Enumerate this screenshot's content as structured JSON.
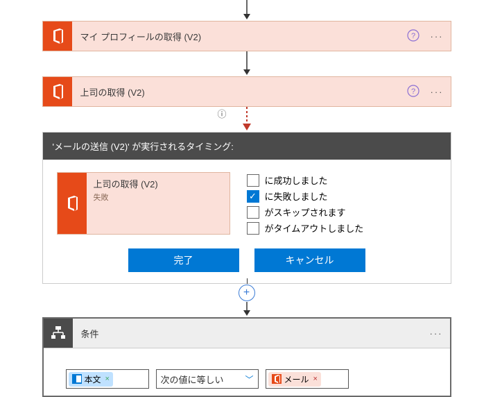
{
  "actions": {
    "profile": {
      "title": "マイ プロフィールの取得 (V2)"
    },
    "manager": {
      "title": "上司の取得 (V2)"
    }
  },
  "runAfter": {
    "heading": "'メールの送信 (V2)' が実行されるタイミング:",
    "source": {
      "title": "上司の取得 (V2)",
      "status": "失敗"
    },
    "options": {
      "succeeded": "に成功しました",
      "failed": "に失敗しました",
      "skipped": "がスキップされます",
      "timedout": "がタイムアウトしました"
    },
    "checked": {
      "succeeded": false,
      "failed": true,
      "skipped": false,
      "timedout": false
    },
    "buttons": {
      "done": "完了",
      "cancel": "キャンセル"
    }
  },
  "condition": {
    "title": "条件",
    "tokens": {
      "body": "本文",
      "mail": "メール"
    },
    "operator": "次の値に等しい"
  },
  "icons": {
    "help": "?",
    "more": "···",
    "close": "×",
    "check": "✓",
    "plus": "+",
    "info": "ⓘ"
  }
}
